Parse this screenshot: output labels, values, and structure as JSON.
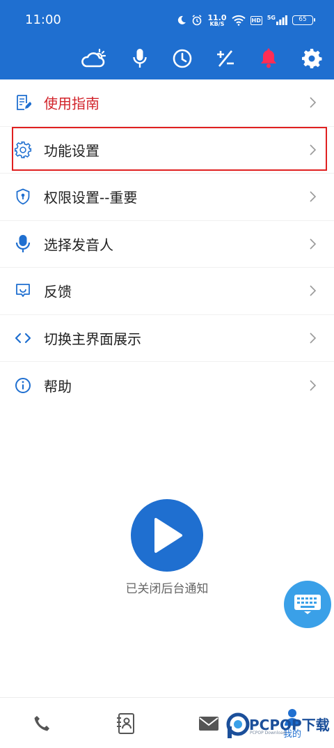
{
  "status_bar": {
    "time": "11:00",
    "net_speed_value": "11.0",
    "net_speed_unit": "KB/S",
    "hd": "HD",
    "network": "5G",
    "battery": "65"
  },
  "toolbar": {
    "icons": [
      "weather-icon",
      "microphone-icon",
      "clock-icon",
      "plus-minus-icon",
      "bell-icon",
      "gear-icon"
    ],
    "bell_color": "#ff2d55"
  },
  "menu": {
    "items": [
      {
        "label": "使用指南",
        "icon": "guide-icon",
        "accent": "#d2232a"
      },
      {
        "label": "功能设置",
        "icon": "settings-icon"
      },
      {
        "label": "权限设置--重要",
        "icon": "shield-icon"
      },
      {
        "label": "选择发音人",
        "icon": "microphone-icon"
      },
      {
        "label": "反馈",
        "icon": "feedback-icon"
      },
      {
        "label": "切换主界面展示",
        "icon": "code-icon"
      },
      {
        "label": "帮助",
        "icon": "info-icon"
      }
    ]
  },
  "main": {
    "notice": "已关闭后台通知"
  },
  "bottom_nav": {
    "items": [
      {
        "icon": "phone-icon"
      },
      {
        "icon": "contacts-icon"
      },
      {
        "icon": "mail-icon"
      },
      {
        "icon": "profile-icon",
        "label": "我的"
      }
    ]
  },
  "watermark": {
    "text": "PCPOP下载",
    "sub": "PCPOP Download"
  },
  "colors": {
    "primary": "#1f6fd0",
    "highlight_border": "#e02020",
    "fab": "#3aa0e8"
  }
}
